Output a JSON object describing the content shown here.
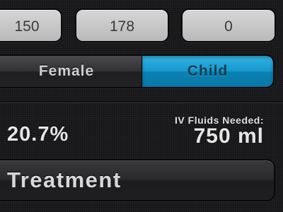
{
  "inputs": {
    "field_1": "150",
    "field_2": "178",
    "field_3": "0"
  },
  "gender_selector": {
    "options": [
      "Female",
      "Child"
    ],
    "selected": "Child"
  },
  "result": {
    "percentage": "20.7%",
    "iv_fluids_label": "IV Fluids Needed:",
    "iv_fluids_value": "750 ml"
  },
  "treatment": {
    "label": "Treatment"
  },
  "colors": {
    "accent": "#1497cb",
    "background": "#1c1c1e",
    "field": "#c8c8c8"
  }
}
